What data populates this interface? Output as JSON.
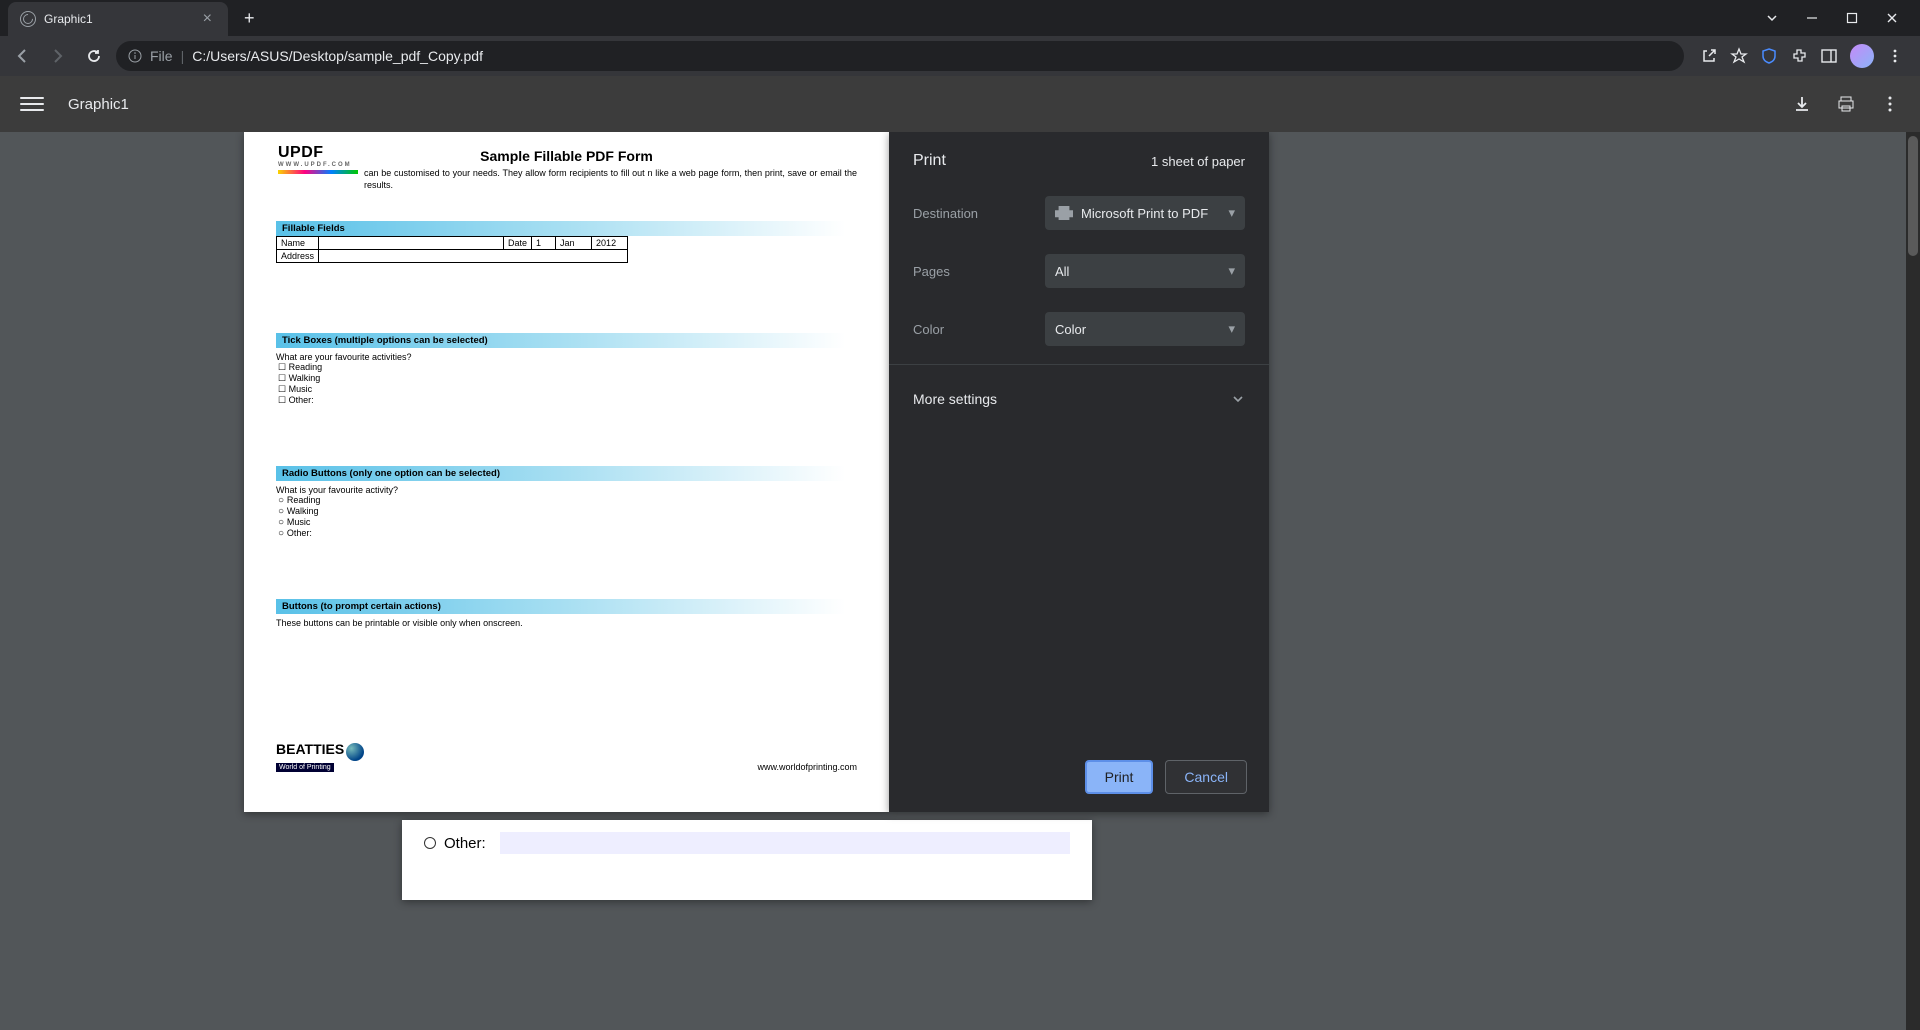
{
  "browser": {
    "tab_title": "Graphic1",
    "url_prefix": "File",
    "url_path": "C:/Users/ASUS/Desktop/sample_pdf_Copy.pdf"
  },
  "pdf_toolbar": {
    "title": "Graphic1"
  },
  "doc": {
    "logo": "UPDF",
    "logo_sub": "WWW.UPDF.COM",
    "title": "Sample Fillable PDF Form",
    "intro": "can be customised to your needs. They allow form recipients to fill out n like a web page form, then print, save or email the results.",
    "sec1": "Fillable Fields",
    "name_lbl": "Name",
    "date_lbl": "Date",
    "date_d": "1",
    "date_m": "Jan",
    "date_y": "2012",
    "addr_lbl": "Address",
    "sec2": "Tick Boxes (multiple options can be selected)",
    "q2": "What are your favourite activities?",
    "opts": [
      "Reading",
      "Walking",
      "Music",
      "Other:"
    ],
    "sec3": "Radio Buttons (only one option can be selected)",
    "q3": "What is your favourite activity?",
    "sec4": "Buttons (to prompt certain actions)",
    "p4": "These buttons can be printable or visible only when onscreen.",
    "footer_brand": "BEATTIES",
    "footer_brand_sub": "World of Printing",
    "footer_url": "www.worldofprinting.com"
  },
  "behind": {
    "other": "Other:"
  },
  "print": {
    "title": "Print",
    "sheets": "1 sheet of paper",
    "dest_label": "Destination",
    "dest_value": "Microsoft Print to PDF",
    "pages_label": "Pages",
    "pages_value": "All",
    "color_label": "Color",
    "color_value": "Color",
    "more": "More settings",
    "print_btn": "Print",
    "cancel_btn": "Cancel"
  }
}
